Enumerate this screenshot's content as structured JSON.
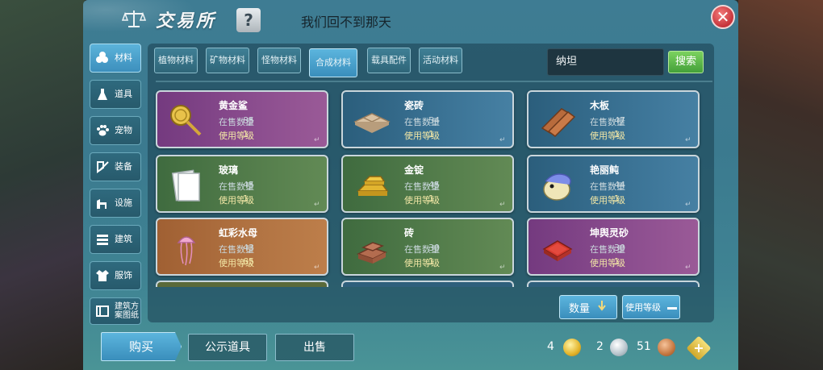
{
  "window": {
    "title": "交易所",
    "subtitle": "我们回不到那天",
    "help_label": "?",
    "close_label": "✕"
  },
  "sidebar": {
    "items": [
      {
        "label": "材料",
        "icon": "materials-icon",
        "active": true
      },
      {
        "label": "道具",
        "icon": "potion-icon",
        "active": false
      },
      {
        "label": "宠物",
        "icon": "paw-icon",
        "active": false
      },
      {
        "label": "装备",
        "icon": "equipment-icon",
        "active": false
      },
      {
        "label": "设施",
        "icon": "facility-icon",
        "active": false
      },
      {
        "label": "建筑",
        "icon": "building-icon",
        "active": false
      },
      {
        "label": "服饰",
        "icon": "clothing-icon",
        "active": false
      },
      {
        "label": "建筑方案图纸",
        "icon": "blueprint-icon",
        "active": false
      }
    ]
  },
  "tabs": [
    {
      "label": "植物材料",
      "active": false
    },
    {
      "label": "矿物材料",
      "active": false
    },
    {
      "label": "怪物材料",
      "active": false
    },
    {
      "label": "合成材料",
      "active": true
    },
    {
      "label": "载具配件",
      "active": false
    },
    {
      "label": "活动材料",
      "active": false
    }
  ],
  "search": {
    "value": "纳坦",
    "button_label": "搜索"
  },
  "labels": {
    "on_sale": "在售数量",
    "use_level": "使用等级"
  },
  "items": [
    {
      "name": "黄金鲨",
      "on_sale": "85",
      "use_level": "1",
      "rarity": "purple",
      "icon": "golden-fan-icon"
    },
    {
      "name": "瓷砖",
      "on_sale": "54",
      "use_level": "1",
      "rarity": "blue",
      "icon": "tile-icon"
    },
    {
      "name": "木板",
      "on_sale": "47",
      "use_level": "1",
      "rarity": "blue",
      "icon": "plank-icon"
    },
    {
      "name": "玻璃",
      "on_sale": "45",
      "use_level": "1",
      "rarity": "green",
      "icon": "glass-icon"
    },
    {
      "name": "金锭",
      "on_sale": "45",
      "use_level": "1",
      "rarity": "green",
      "icon": "gold-ingot-icon"
    },
    {
      "name": "艳丽鲀",
      "on_sale": "44",
      "use_level": "1",
      "rarity": "blue",
      "icon": "pufferfish-icon"
    },
    {
      "name": "虹彩水母",
      "on_sale": "43",
      "use_level": "65",
      "rarity": "orange",
      "icon": "jellyfish-icon"
    },
    {
      "name": "砖",
      "on_sale": "30",
      "use_level": "1",
      "rarity": "green",
      "icon": "brick-icon"
    },
    {
      "name": "坤舆灵砂",
      "on_sale": "30",
      "use_level": "1",
      "rarity": "purple",
      "icon": "red-sand-icon"
    }
  ],
  "sort": {
    "quantity_label": "数量",
    "level_label": "使用等级"
  },
  "bottom": {
    "buy_label": "购买",
    "public_label": "公示道具",
    "sell_label": "出售",
    "gold": "4",
    "silver": "2",
    "bronze": "51"
  },
  "colors": {
    "purple": "#8c4e8f",
    "blue": "#3b7395",
    "green": "#557e4c",
    "orange": "#b27443",
    "active_tab": "#3a8ebc",
    "search_button": "#44a03a",
    "close": "#c6333a"
  }
}
